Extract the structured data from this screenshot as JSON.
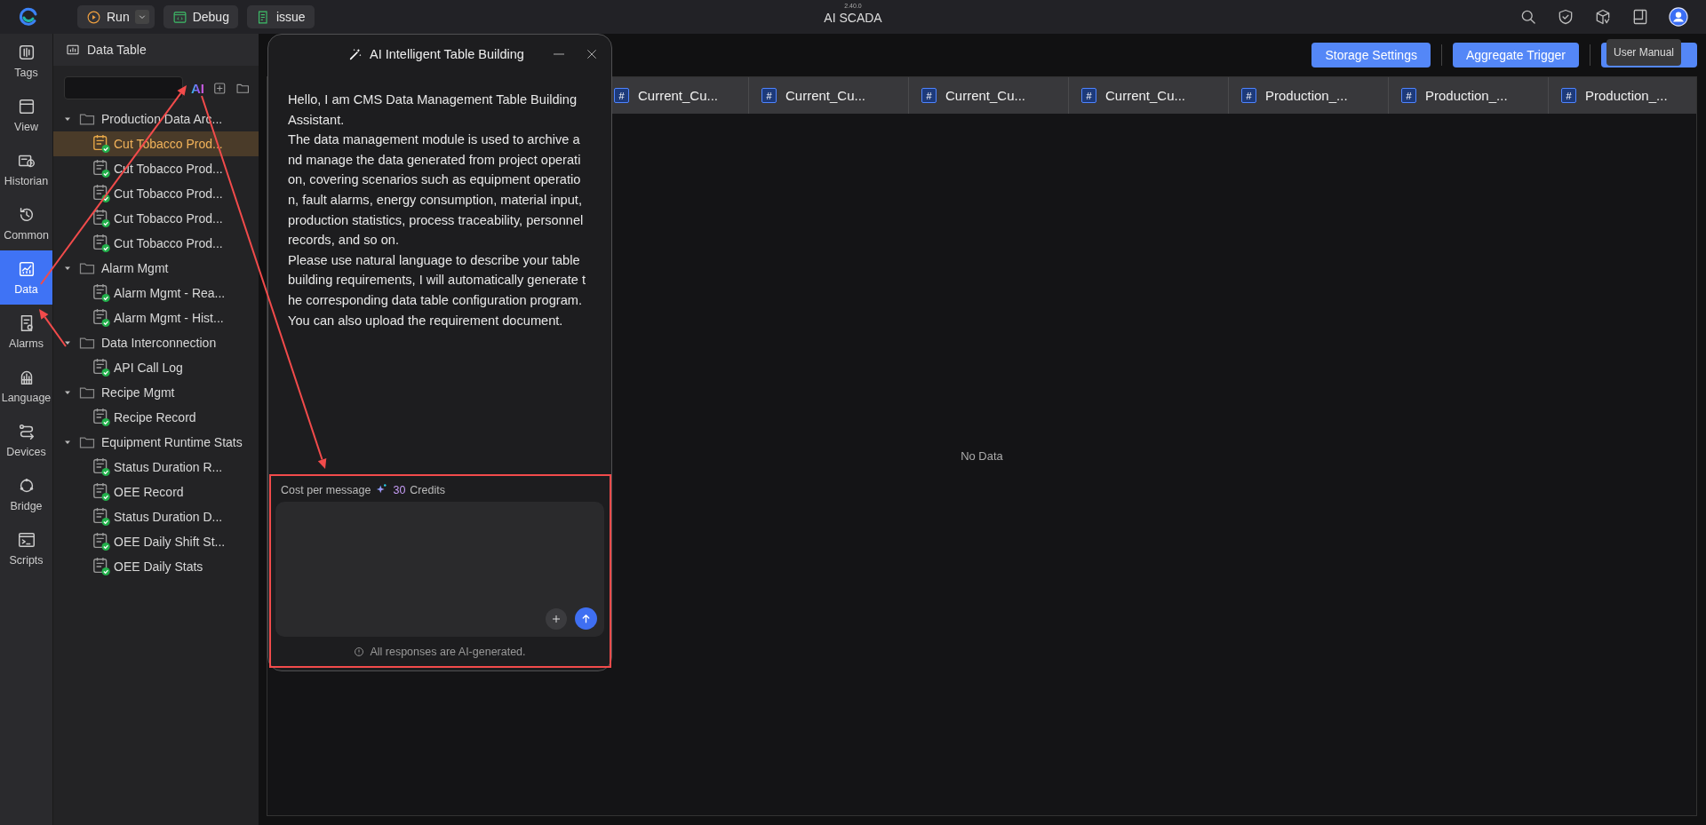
{
  "top_bar": {
    "buttons": [
      {
        "kind": "run",
        "label": "Run"
      },
      {
        "kind": "debug",
        "label": "Debug"
      },
      {
        "kind": "issue",
        "label": "issue"
      }
    ],
    "version": "2.40.0",
    "app_title": "AI SCADA",
    "tooltip": "User Manual"
  },
  "rail": {
    "items": [
      {
        "label": "Tags",
        "selected": false
      },
      {
        "label": "View",
        "selected": false
      },
      {
        "label": "Historian",
        "selected": false
      },
      {
        "label": "Common",
        "selected": false
      },
      {
        "label": "Data",
        "selected": true
      },
      {
        "label": "Alarms",
        "selected": false
      },
      {
        "label": "Language",
        "selected": false
      },
      {
        "label": "Devices",
        "selected": false
      },
      {
        "label": "Bridge",
        "selected": false
      },
      {
        "label": "Scripts",
        "selected": false
      }
    ]
  },
  "sidebar": {
    "title": "Data Table",
    "ai_label": "AI",
    "groups": [
      {
        "label": "Production Data Arc...",
        "expanded": true,
        "children": [
          {
            "label": "Cut Tobacco Prod...",
            "selected": true
          },
          {
            "label": "Cut Tobacco Prod...",
            "selected": false
          },
          {
            "label": "Cut Tobacco Prod...",
            "selected": false
          },
          {
            "label": "Cut Tobacco Prod...",
            "selected": false
          },
          {
            "label": "Cut Tobacco Prod...",
            "selected": false
          }
        ]
      },
      {
        "label": "Alarm Mgmt",
        "expanded": true,
        "children": [
          {
            "label": "Alarm Mgmt - Rea...",
            "selected": false
          },
          {
            "label": "Alarm Mgmt - Hist...",
            "selected": false
          }
        ]
      },
      {
        "label": "Data Interconnection",
        "expanded": true,
        "children": [
          {
            "label": "API Call Log",
            "selected": false
          }
        ]
      },
      {
        "label": "Recipe Mgmt",
        "expanded": true,
        "children": [
          {
            "label": "Recipe Record",
            "selected": false
          }
        ]
      },
      {
        "label": "Equipment Runtime Stats",
        "expanded": true,
        "children": [
          {
            "label": "Status Duration R...",
            "selected": false
          },
          {
            "label": "OEE Record",
            "selected": false
          },
          {
            "label": "Status Duration D...",
            "selected": false
          },
          {
            "label": "OEE Daily Shift St...",
            "selected": false
          },
          {
            "label": "OEE Daily Stats",
            "selected": false
          }
        ]
      }
    ]
  },
  "toolbar": {
    "buttons": [
      "Storage Settings",
      "Aggregate Trigger"
    ]
  },
  "table": {
    "columns": [
      {
        "type_mark": "#",
        "label": "Current_Cu..."
      },
      {
        "type_mark": "#",
        "label": "Current_Cu..."
      },
      {
        "type_mark": "#",
        "label": "Current_Cu..."
      },
      {
        "type_mark": "#",
        "label": "Current_Cu..."
      },
      {
        "type_mark": "#",
        "label": "Production_..."
      },
      {
        "type_mark": "#",
        "label": "Production_..."
      },
      {
        "type_mark": "#",
        "label": "Production_..."
      }
    ],
    "empty_text": "No Data"
  },
  "dialog": {
    "title": "AI Intelligent Table Building",
    "messages": [
      "Hello, I am CMS Data Management Table Building Assistant.",
      "The data management module is used to archive and manage the data generated from project operation, covering scenarios such as equipment operation, fault alarms, energy consumption, material input, production statistics, process traceability, personnel records, and so on.",
      "Please use natural language to describe your table building requirements, I will automatically generate the corresponding data table configuration program. You can also upload the requirement document."
    ],
    "cost_label": "Cost per message",
    "credits": "30",
    "credits_unit": "Credits",
    "footer": "All responses are AI-generated."
  }
}
